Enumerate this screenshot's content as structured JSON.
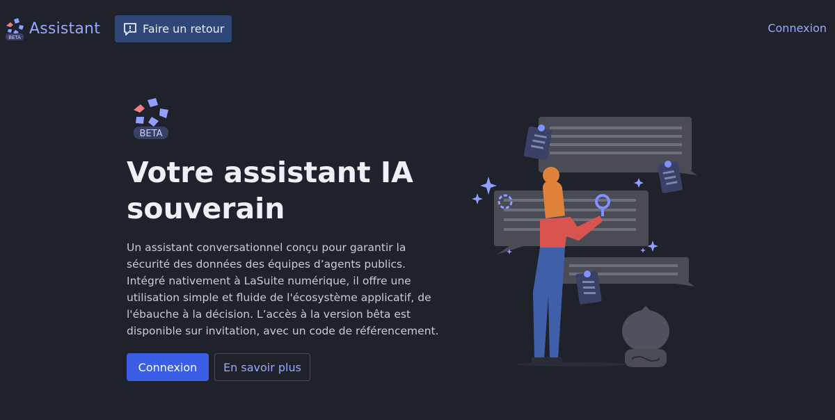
{
  "header": {
    "brand_name": "Assistant",
    "brand_badge": "BETA",
    "feedback_label": "Faire un retour",
    "login_label": "Connexion"
  },
  "hero": {
    "badge": "BETA",
    "title_line1": "Votre assistant IA",
    "title_line2": "souverain",
    "description": "Un assistant conversationnel conçu pour garantir la sécurité des données des équipes d’agents publics. Intégré nativement à LaSuite numérique, il offre une utilisation simple et fluide de l'écosystème applicatif, de l'ébauche à la décision. L’accès à la version bêta est disponible sur invitation, avec un code de référencement.",
    "primary_button": "Connexion",
    "secondary_button": "En savoir plus"
  },
  "colors": {
    "background": "#1f212b",
    "accent": "#9aa8ff",
    "primary": "#3b5ee6",
    "feedback_bg": "#2f4777"
  },
  "icons": {
    "brand": "assistant-logo-icon",
    "feedback": "feedback-icon"
  }
}
